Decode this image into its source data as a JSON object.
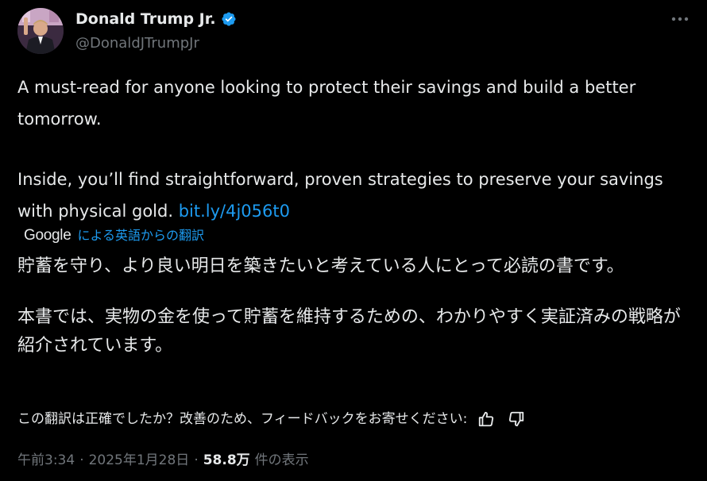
{
  "author": {
    "display_name": "Donald Trump Jr.",
    "handle": "@DonaldJTrumpJr",
    "verified": true
  },
  "icons": {
    "verified": "verified-badge-icon",
    "more": "more-options-icon",
    "thumbs_up": "thumbs-up-icon",
    "thumbs_down": "thumbs-down-icon"
  },
  "tweet": {
    "paragraph1": "A must-read for anyone looking to protect their savings and build a better tomorrow.",
    "paragraph2_text": "Inside, you’ll find straightforward, proven strategies to preserve your savings with physical gold.",
    "link_text": "bit.ly/4j056t0"
  },
  "translation": {
    "provider": "Google",
    "label": "による英語からの翻訳",
    "paragraph1": "貯蓄を守り、より良い明日を築きたいと考えている人にとって必読の書です。",
    "paragraph2": "本書では、実物の金を使って貯蓄を維持するための、わかりやすく実証済みの戦略が紹介されています。",
    "feedback_prompt": "この翻訳は正確でしたか？改善のため、フィードバックをお寄せください:"
  },
  "meta": {
    "time": "午前3:34",
    "separator": "·",
    "date": "2025年1月28日",
    "views_count": "58.8万",
    "views_label": "件の表示"
  },
  "colors": {
    "background": "#000000",
    "text": "#e7e9ea",
    "secondary": "#71767b",
    "accent": "#1d9bf0"
  }
}
